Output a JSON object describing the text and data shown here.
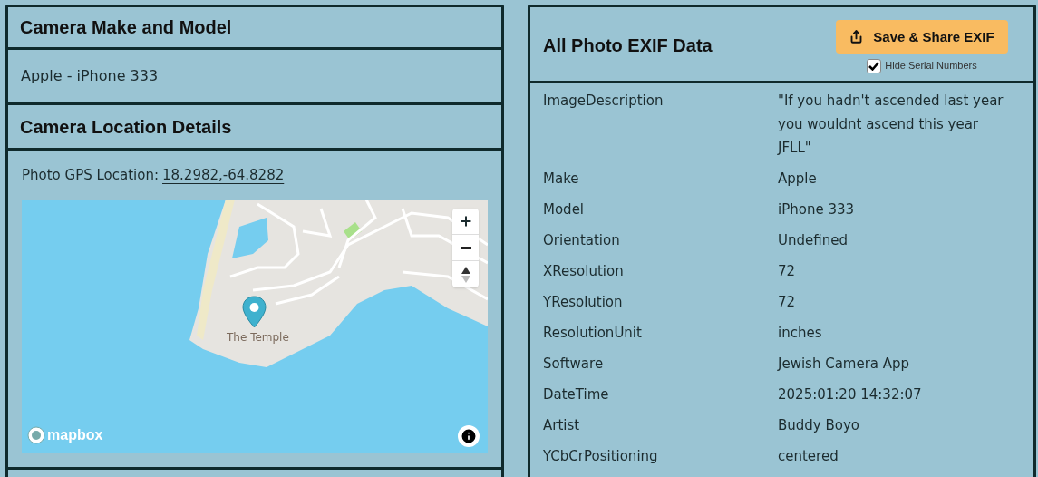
{
  "make_model_panel": {
    "title": "Camera Make and Model",
    "value": "Apple - iPhone 333"
  },
  "location_panel": {
    "title": "Camera Location Details",
    "gps_label": "Photo GPS Location:",
    "gps_link": "18.2982,-64.8282",
    "map": {
      "place_label": "The Temple",
      "attribution_logo": "mapbox"
    }
  },
  "exif_panel": {
    "title": "All Photo EXIF Data",
    "share_button": "Save & Share EXIF",
    "hide_serials": {
      "label": "Hide Serial Numbers",
      "checked": true
    },
    "rows": [
      {
        "tag": "ImageDescription",
        "value": "\"If you hadn't ascended last year you wouldnt ascend this year JFLL\""
      },
      {
        "tag": "Make",
        "value": "Apple"
      },
      {
        "tag": "Model",
        "value": "iPhone 333"
      },
      {
        "tag": "Orientation",
        "value": "Undefined"
      },
      {
        "tag": "XResolution",
        "value": "72"
      },
      {
        "tag": "YResolution",
        "value": "72"
      },
      {
        "tag": "ResolutionUnit",
        "value": "inches"
      },
      {
        "tag": "Software",
        "value": "Jewish Camera App"
      },
      {
        "tag": "DateTime",
        "value": "2025:01:20 14:32:07"
      },
      {
        "tag": "Artist",
        "value": "Buddy Boyo"
      },
      {
        "tag": "YCbCrPositioning",
        "value": "centered"
      }
    ]
  }
}
